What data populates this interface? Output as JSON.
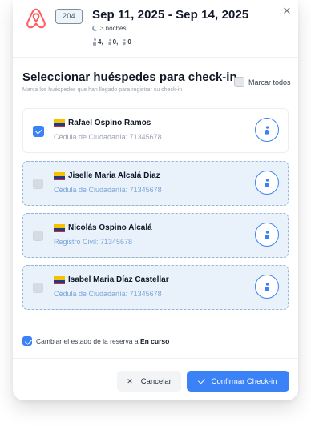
{
  "header": {
    "logo_icon": "airbnb-logo",
    "brand_color": "#ff5a5f",
    "reservation_code": "204",
    "date_range": "Sep 11, 2025 - Sep 14, 2025",
    "nights_label": "3 noches",
    "counts": {
      "adults": "4,",
      "children": "0,",
      "infants": "0"
    },
    "close_icon": "close-icon"
  },
  "section": {
    "title": "Seleccionar huéspedes para check-in",
    "subtitle": "Marca los huéspedes que han llegado para registrar su check-in",
    "select_all_label": "Marcar todos",
    "select_all_checked": false
  },
  "guests": [
    {
      "name": "Rafael Ospino Ramos",
      "document": "Cédula de Ciudadanía: 71345678",
      "checked": true,
      "flag": "colombia-flag"
    },
    {
      "name": "Jiselle Maria Alcalá Diaz",
      "document": "Cédula de Ciudadanía: 71345678",
      "checked": false,
      "flag": "colombia-flag"
    },
    {
      "name": "Nicolás Ospino Alcalá",
      "document": "Registro Civil: 71345678",
      "checked": false,
      "flag": "colombia-flag"
    },
    {
      "name": "Isabel Maria Díaz Castellar",
      "document": "Cédula de Ciudadanía: 71345678",
      "checked": false,
      "flag": "colombia-flag"
    }
  ],
  "status": {
    "label_prefix": "Cambiar el estado de la reserva a",
    "label_state": "En curso",
    "checked": true
  },
  "actions": {
    "cancel_label": "Cancelar",
    "confirm_label": "Confirmar Check-in"
  },
  "colors": {
    "accent": "#3b82f6",
    "pending_bg": "#e9f1fb",
    "pending_border": "#93b3d8"
  }
}
